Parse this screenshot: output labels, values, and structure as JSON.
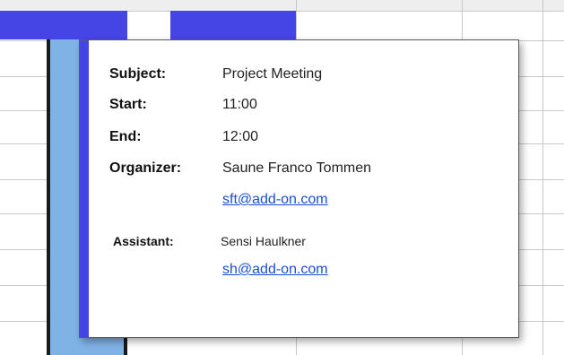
{
  "appointment": {
    "subject_label": "Subject:",
    "subject": "Project Meeting",
    "start_label": "Start:",
    "start": "11:00",
    "end_label": "End:",
    "end": "12:00",
    "organizer_label": "Organizer:",
    "organizer_name": "Saune Franco Tommen",
    "organizer_email": "sft@add-on.com",
    "assistant_label": "Assistant:",
    "assistant_name": "Sensi Haulkner",
    "assistant_email": "sh@add-on.com"
  },
  "colors": {
    "appointment_block": "#4545e6",
    "selected_column": "#7fb3e6",
    "link": "#1a4fd6"
  }
}
